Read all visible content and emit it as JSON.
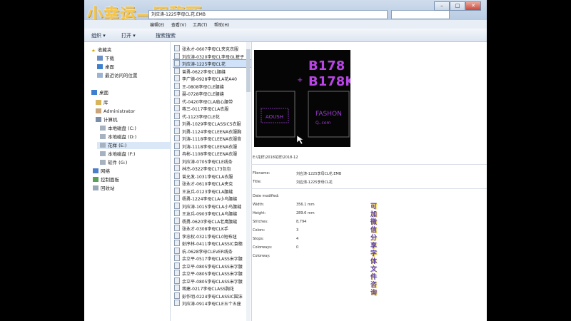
{
  "window": {
    "overlay_title": "小幸运—田馥甄",
    "address": "刘应涛-1225李母CL花.EMB",
    "controls": {
      "minimize": "–",
      "maximize": "□",
      "close": "✕"
    }
  },
  "menu": {
    "items": [
      "编辑(E)",
      "查看(V)",
      "工具(T)",
      "帮助(H)"
    ]
  },
  "toolbar": {
    "organize": "组织 ▾",
    "open": "打开 ▾",
    "search": "搜索搜索"
  },
  "nav": {
    "favorites": "收藏夹",
    "downloads": "下载",
    "desktop": "桌面",
    "recent": "最近访问的位置",
    "desktop2": "桌面",
    "library": "库",
    "admin": "Administrator",
    "computer": "计算机",
    "disk_c": "本地磁盘 (C:)",
    "disk_d": "本地磁盘 (D:)",
    "disk_e": "花样 (E:)",
    "disk_f": "本地磁盘 (F:)",
    "disk_g": "软件 (G:)",
    "network": "网络",
    "control_panel": "控制面板",
    "recycle": "回收站"
  },
  "files": [
    {
      "name": "张永才-0607李母CL夹克衣服"
    },
    {
      "name": "刘应涛-0320李母CL李母GL裤子"
    },
    {
      "name": "刘应涛-1225李母CL花"
    },
    {
      "name": "曾勇-0622李母CL腰缝"
    },
    {
      "name": "李广德-0928李母CLA花A40"
    },
    {
      "name": "王-0808李母CLE腰缝"
    },
    {
      "name": "聂-0728李母CLE腰缝"
    },
    {
      "name": "代-0420李母CLA肩心腰带"
    },
    {
      "name": "蒋三-0117李母CLA衣服"
    },
    {
      "name": "代-1123李母CLE花"
    },
    {
      "name": "刘勇-1029李母CLASSICS衣服"
    },
    {
      "name": "刘勇-1124李母CLEENA衣服胸"
    },
    {
      "name": "刘涛-1118李母CLEENA衣服背"
    },
    {
      "name": "刘涛-1118李母CLEENA衣服"
    },
    {
      "name": "冉彬-1108李母CLEENA衣服"
    },
    {
      "name": "刘应涛-0705李母CLE线条"
    },
    {
      "name": "林杰-0322李母CL73包包"
    },
    {
      "name": "曾允发-1031李母CLA衣服"
    },
    {
      "name": "张永才-0610李母CLA夹克"
    },
    {
      "name": "王友兵-0123李母CLA腰缝"
    },
    {
      "name": "杨勇-1224李母CLA小鸟腰缝"
    },
    {
      "name": "刘应涛-1015李母CLA小鸟腰缝"
    },
    {
      "name": "王友兵-0903李母CLA鸟腰缝"
    },
    {
      "name": "杨勇-0620李母CLA老鹰腰缝"
    },
    {
      "name": "张永才-0308李母CLK手"
    },
    {
      "name": "李忠权-0321李母CL0短布纽"
    },
    {
      "name": "彭序林-0411李母CLASSIC袁穗"
    },
    {
      "name": "杭-0628李母CLEVER线条"
    },
    {
      "name": "余立平-0517李母CLASS米字腰"
    },
    {
      "name": "余立平-0805李母CLASS米字腰"
    },
    {
      "name": "余立平-0805李母CLASS米字腰"
    },
    {
      "name": "余立平-0805李母CLASS米字腰"
    },
    {
      "name": "蒋建-0217李母CLASS胸花"
    },
    {
      "name": "彭作明-0224李母CLASSIC围沫"
    },
    {
      "name": "刘应涛-0914李母CLE五个五座"
    }
  ],
  "preview": {
    "label_top": "B178",
    "label_mid": "B178K",
    "left_patch": "AOUSH",
    "right_patch_top": "FASHON",
    "right_patch_bottom": "Q..com",
    "path": "E:\\花样\\2018花样\\2018-12"
  },
  "properties": {
    "filename_label": "Filename:",
    "filename_value": "刘应涛-1225李母CL花.EMB",
    "title_label": "Title:",
    "title_value": "刘应涛-1225李母CL花",
    "date_label": "Date modified:",
    "width_label": "Width:",
    "width_value": "356.1 mm",
    "height_label": "Height:",
    "height_value": "289.6 mm",
    "stitches_label": "Stitches:",
    "stitches_value": "8,794",
    "colors_label": "Colors:",
    "colors_value": "3",
    "stops_label": "Stops:",
    "stops_value": "4",
    "colorways_label": "Colorways:",
    "colorways_value": "0",
    "colorway_label": "Colorway:"
  },
  "watermark": "可加微信分享字体文件咨询",
  "colors": {
    "highlight": "#f3e28a",
    "selection": "#cfe2fa",
    "preview_text": "#b844e6"
  }
}
